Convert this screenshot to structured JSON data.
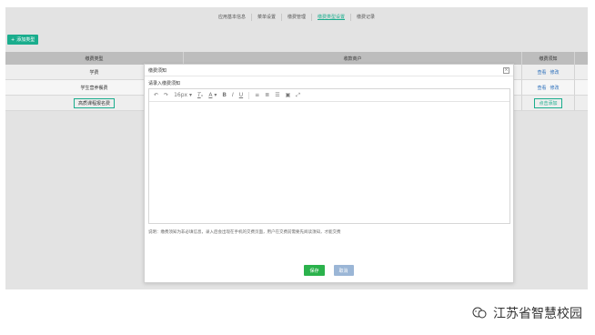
{
  "nav": {
    "items": [
      {
        "label": "应用基本信息"
      },
      {
        "label": "菜单设置"
      },
      {
        "label": "缴费管理"
      },
      {
        "label": "缴费类型设置",
        "active": true
      },
      {
        "label": "缴费记录"
      }
    ]
  },
  "toolbar": {
    "add_type_label": "添加类型"
  },
  "table": {
    "headers": [
      "缴费类型",
      "收款商户",
      "缴费须知"
    ],
    "rows": [
      {
        "type": "学费",
        "merchant": "",
        "actions": [
          "查看",
          "修改"
        ]
      },
      {
        "type": "学生营养餐费",
        "merchant": "",
        "actions": [
          "查看",
          "修改"
        ]
      },
      {
        "type": "高质课程报名费",
        "merchant": "",
        "actions": [
          "点击添加"
        ]
      }
    ]
  },
  "modal": {
    "title": "缴费须知",
    "prompt": "请录入缴费须知",
    "font_size": "16px",
    "note": "说明：缴费须知为非必填信息，录入后会出现在手机的交费页面，用户在交费前需要先阅读须知，才能交费",
    "save_label": "保存",
    "cancel_label": "取消"
  },
  "watermark": {
    "text": "江苏省智慧校园"
  },
  "colors": {
    "accent": "#1aad8d",
    "save": "#2bb24c",
    "cancel": "#9bb6d6",
    "link": "#2a6ebb"
  }
}
